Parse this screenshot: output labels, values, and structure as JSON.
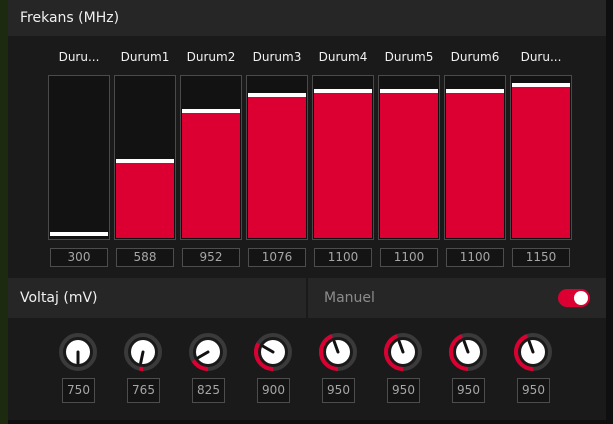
{
  "frequency": {
    "title": "Frekans (MHz)",
    "max": 1200,
    "states": [
      {
        "label": "Duru...",
        "value": "300",
        "level": 300
      },
      {
        "label": "Durum1",
        "value": "588",
        "level": 588
      },
      {
        "label": "Durum2",
        "value": "952",
        "level": 952
      },
      {
        "label": "Durum3",
        "value": "1076",
        "level": 1076
      },
      {
        "label": "Durum4",
        "value": "1100",
        "level": 1100
      },
      {
        "label": "Durum5",
        "value": "1100",
        "level": 1100
      },
      {
        "label": "Durum6",
        "value": "1100",
        "level": 1100
      },
      {
        "label": "Duru...",
        "value": "1150",
        "level": 1150
      }
    ]
  },
  "voltage": {
    "title": "Voltaj (mV)",
    "manual_label": "Manuel",
    "manual_on": true,
    "min": 750,
    "max": 1200,
    "states": [
      {
        "value": "750",
        "level": 750
      },
      {
        "value": "765",
        "level": 765
      },
      {
        "value": "825",
        "level": 825
      },
      {
        "value": "900",
        "level": 900
      },
      {
        "value": "950",
        "level": 950
      },
      {
        "value": "950",
        "level": 950
      },
      {
        "value": "950",
        "level": 950
      },
      {
        "value": "950",
        "level": 950
      }
    ]
  },
  "colors": {
    "accent": "#dc0032",
    "panel": "#1a1a1b",
    "header": "#262627"
  },
  "icons": {
    "knob": "rotary-knob-icon"
  }
}
